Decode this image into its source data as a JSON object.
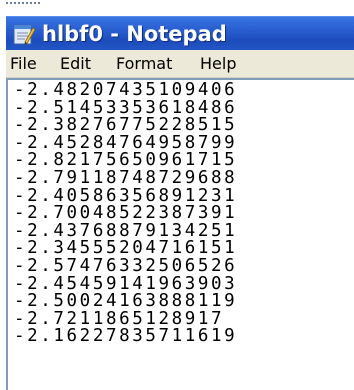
{
  "window": {
    "title": "hlbf0 - Notepad",
    "icon": "notepad-icon"
  },
  "menu": {
    "items": [
      {
        "label": "File"
      },
      {
        "label": "Edit"
      },
      {
        "label": "Format"
      },
      {
        "label": "Help"
      }
    ]
  },
  "editor": {
    "lines": [
      "-2.48207435109406",
      "-2.51453353618486",
      "-2.38276775228515",
      "-2.45284764958799",
      "-2.82175650961715",
      "-2.79118748729688",
      "-2.40586356891231",
      "-2.70048522387391",
      "-2.43768879134251",
      "-2.34555204716151",
      "-2.57476332506526",
      "-2.45459141963903",
      "-2.50024163888119",
      "-2.7211865128917",
      "-2.16227835711619"
    ]
  },
  "colors": {
    "titlebar": "#2a5fd1",
    "menubar": "#ece9d8",
    "frame_border": "#7f9db9"
  }
}
